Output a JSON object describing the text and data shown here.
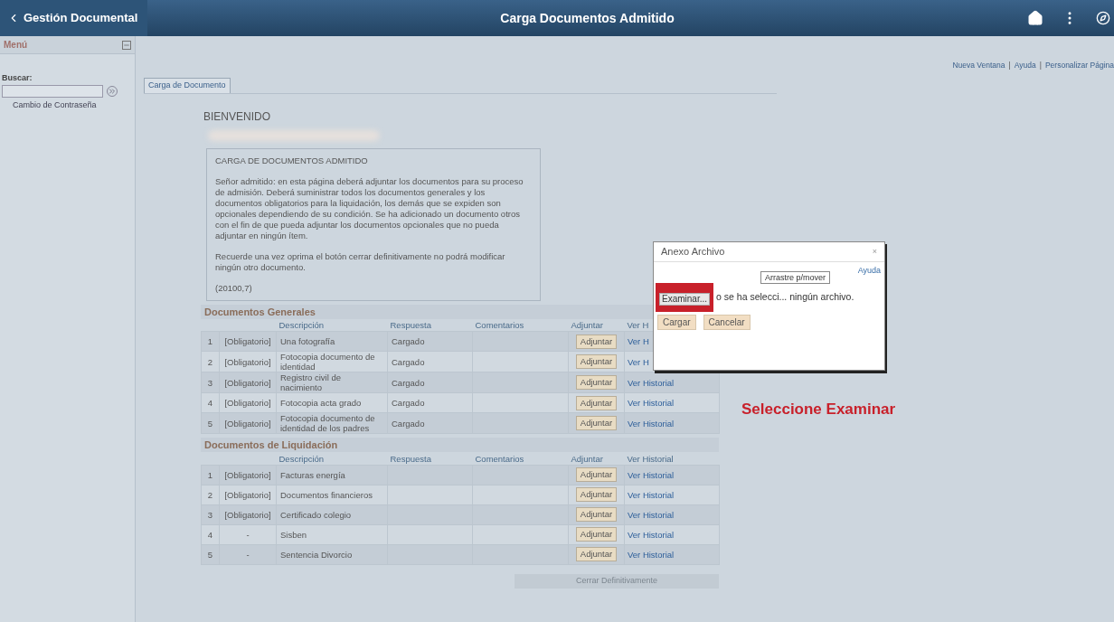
{
  "header": {
    "back_label": "Gestión Documental",
    "title": "Carga Documentos Admitido"
  },
  "sidebar": {
    "title": "Menú",
    "search_label": "Buscar:",
    "links": [
      "Cambio de Contraseña"
    ]
  },
  "top_links": {
    "items": [
      "Nueva Ventana",
      "Ayuda",
      "Personalizar Página"
    ],
    "separator": "|"
  },
  "tabs": [
    {
      "label": "Carga de Documento",
      "selected": true
    }
  ],
  "welcome": "BIENVENIDO",
  "intro": {
    "title": "CARGA DE DOCUMENTOS ADMITIDO",
    "paragraphs": [
      "Señor admitido: en esta página deberá adjuntar los documentos para su proceso de admisión. Deberá suministrar todos los documentos generales y los documentos obligatorios para la liquidación, los demás que se expiden son opcionales dependiendo de su condición. Se ha adicionado un documento otros con el fin de que pueda adjuntar los documentos opcionales que no pueda adjuntar en ningún ítem.",
      "Recuerde una vez oprima el botón cerrar definitivamente no podrá modificar ningún otro documento.",
      "(20100,7)"
    ]
  },
  "sections": [
    {
      "title": "Documentos Generales",
      "columns": [
        "Descripción",
        "Respuesta",
        "Comentarios",
        "Adjuntar",
        "Ver H"
      ],
      "rows": [
        {
          "num": "1",
          "requirement": "[Obligatorio]",
          "description": "Una fotografía",
          "response": "Cargado",
          "attach": "Adjuntar",
          "history": "Ver H"
        },
        {
          "num": "2",
          "requirement": "[Obligatorio]",
          "description": "Fotocopia documento de identidad",
          "response": "Cargado",
          "attach": "Adjuntar",
          "history": "Ver H"
        },
        {
          "num": "3",
          "requirement": "[Obligatorio]",
          "description": "Registro civil de nacimiento",
          "response": "Cargado",
          "attach": "Adjuntar",
          "history": "Ver Historial"
        },
        {
          "num": "4",
          "requirement": "[Obligatorio]",
          "description": "Fotocopia acta grado",
          "response": "Cargado",
          "attach": "Adjuntar",
          "history": "Ver Historial"
        },
        {
          "num": "5",
          "requirement": "[Obligatorio]",
          "description": "Fotocopia documento de identidad de los padres",
          "response": "Cargado",
          "attach": "Adjuntar",
          "history": "Ver Historial"
        }
      ]
    },
    {
      "title": "Documentos de Liquidación",
      "columns": [
        "Descripción",
        "Respuesta",
        "Comentarios",
        "Adjuntar",
        "Ver Historial"
      ],
      "rows": [
        {
          "num": "1",
          "requirement": "[Obligatorio]",
          "description": "Facturas energía",
          "attach": "Adjuntar",
          "history": "Ver Historial"
        },
        {
          "num": "2",
          "requirement": "[Obligatorio]",
          "description": "Documentos financieros",
          "attach": "Adjuntar",
          "history": "Ver Historial"
        },
        {
          "num": "3",
          "requirement": "[Obligatorio]",
          "description": "Certificado colegio",
          "attach": "Adjuntar",
          "history": "Ver Historial"
        },
        {
          "num": "4",
          "requirement": "-",
          "description": "Sisben",
          "attach": "Adjuntar",
          "history": "Ver Historial"
        },
        {
          "num": "5",
          "requirement": "-",
          "description": "Sentencia Divorcio",
          "attach": "Adjuntar",
          "history": "Ver Historial"
        }
      ]
    }
  ],
  "close_button": {
    "label": "Cerrar Definitivamente",
    "disabled": true
  },
  "dialog": {
    "title": "Anexo Archivo",
    "close": "×",
    "help": "Ayuda",
    "browse": "Examinar...",
    "browse_highlighted": true,
    "file_status": "o se ha selecci... ningún archivo.",
    "tooltip": "Arrastre p/mover",
    "buttons": [
      "Cargar",
      "Cancelar"
    ]
  },
  "callout": "Seleccione Examinar"
}
